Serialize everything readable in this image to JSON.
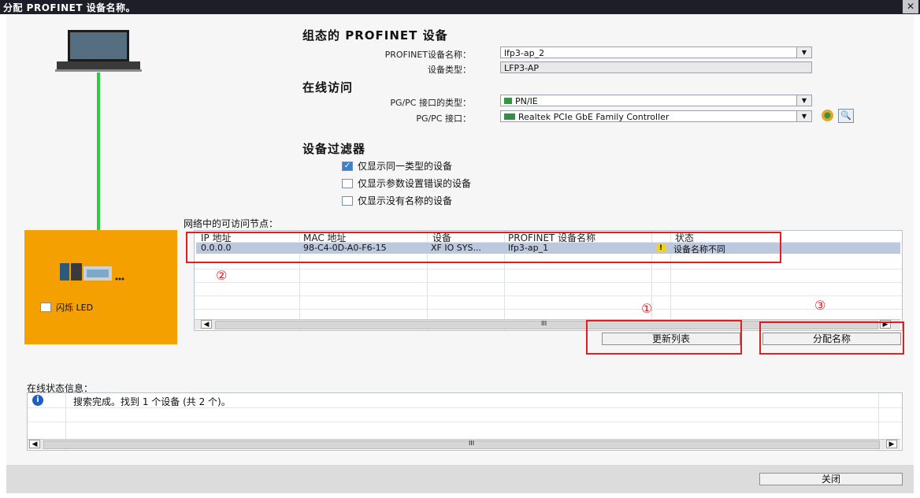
{
  "title": "分配 PROFINET 设备名称。",
  "close_x": "✕",
  "configured": {
    "heading": "组态的 PROFINET 设备",
    "name_label": "PROFINET设备名称：",
    "name_value": "lfp3-ap_2",
    "type_label": "设备类型：",
    "type_value": "LFP3-AP"
  },
  "online": {
    "heading": "在线访问",
    "if_type_label": "PG/PC 接口的类型：",
    "if_type_value": "PN/IE",
    "if_label": "PG/PC 接口：",
    "if_value": "Realtek PCIe GbE Family Controller"
  },
  "filter": {
    "heading": "设备过滤器",
    "options": [
      {
        "label": "仅显示同一类型的设备",
        "checked": true
      },
      {
        "label": "仅显示参数设置错误的设备",
        "checked": false
      },
      {
        "label": "仅显示没有名称的设备",
        "checked": false
      }
    ]
  },
  "flash_led": "闪烁 LED",
  "nodes": {
    "label": "网络中的可访问节点：",
    "columns": [
      "IP 地址",
      "MAC 地址",
      "设备",
      "PROFINET 设备名称",
      "状态"
    ],
    "rows": [
      {
        "ip": "0.0.0.0",
        "mac": "98-C4-0D-A0-F6-15",
        "device": "XF IO SYS...",
        "name": "lfp3-ap_1",
        "status": "设备名称不同"
      }
    ],
    "scroll_mid": "III"
  },
  "buttons": {
    "refresh": "更新列表",
    "assign": "分配名称",
    "close": "关闭"
  },
  "annotations": [
    "②",
    "①",
    "③"
  ],
  "status": {
    "label": "在线状态信息：",
    "message": "搜索完成。找到 1 个设备 (共 2 个)。",
    "scroll_mid": "III"
  },
  "colors": {
    "accent_red": "#e02020",
    "orange": "#f4a000",
    "cable_green": "#2ecc40"
  }
}
